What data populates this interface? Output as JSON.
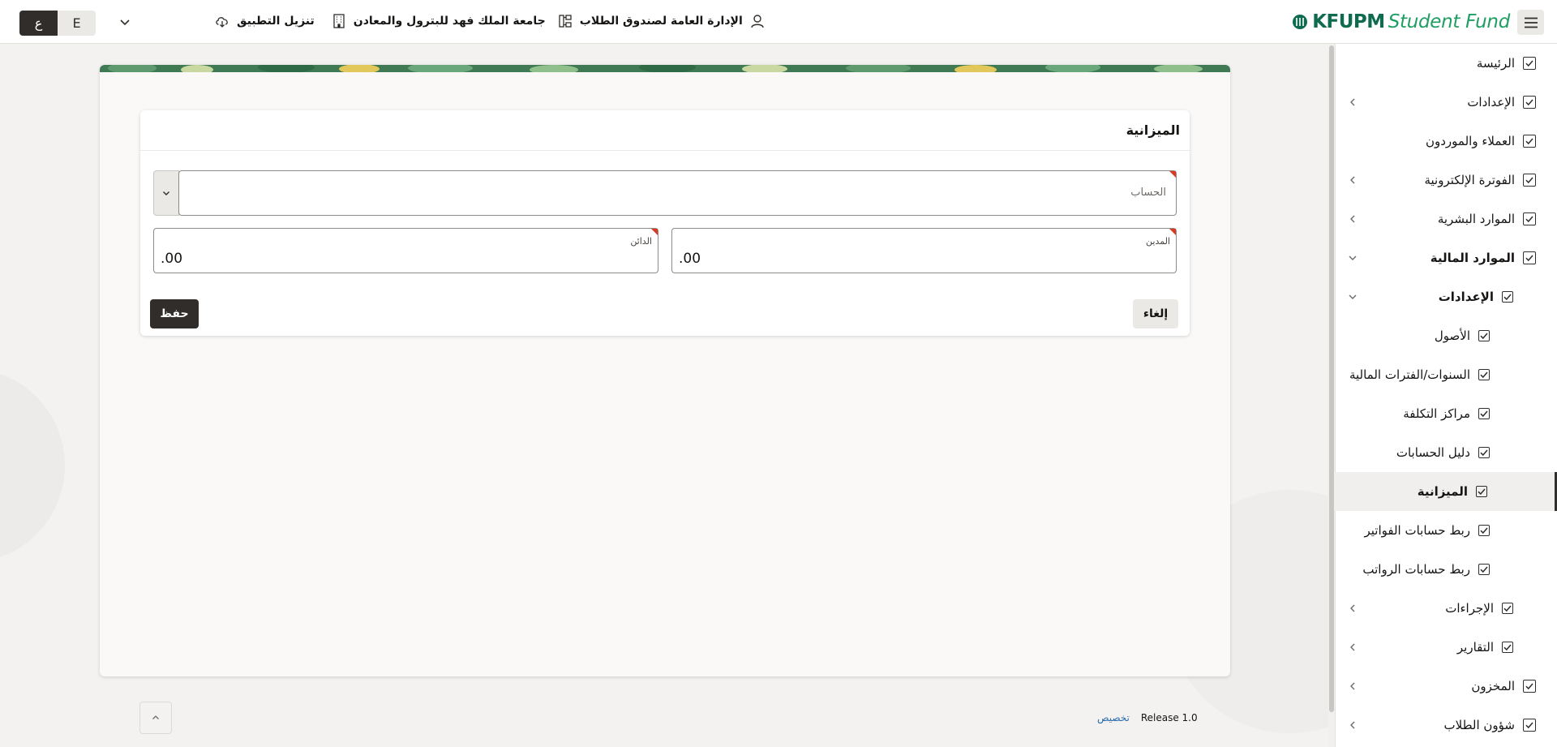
{
  "header": {
    "lang_ar": "ع",
    "lang_en": "E",
    "download_app": "تنزيل التطبيق",
    "university": "جامعة الملك فهد للبترول والمعادن",
    "department": "الإدارة العامة لصندوق الطلاب",
    "brand_kfupm": "KFUPM",
    "brand_student_fund": "Student Fund",
    "icons": [
      "chevron-down-icon",
      "user-icon",
      "org-chart-icon",
      "building-icon",
      "cloud-download-icon",
      "hamburger-menu-icon"
    ]
  },
  "sidebar": {
    "items": [
      {
        "label": "الرئيسة",
        "level": 0,
        "expandable": false
      },
      {
        "label": "الإعدادات",
        "level": 0,
        "expandable": true
      },
      {
        "label": "العملاء والموردون",
        "level": 0,
        "expandable": false
      },
      {
        "label": "الفوترة الإلكترونية",
        "level": 0,
        "expandable": true
      },
      {
        "label": "الموارد البشرية",
        "level": 0,
        "expandable": true
      },
      {
        "label": "الموارد المالية",
        "level": 0,
        "expandable": true,
        "expanded": true,
        "bold": true
      },
      {
        "label": "الإعدادات",
        "level": 1,
        "expandable": true,
        "expanded": true,
        "bold": true
      },
      {
        "label": "الأصول",
        "level": 2
      },
      {
        "label": "السنوات/الفترات المالية",
        "level": 2
      },
      {
        "label": "مراكز التكلفة",
        "level": 2
      },
      {
        "label": "دليل الحسابات",
        "level": 2
      },
      {
        "label": "الميزانية",
        "level": 2,
        "selected": true,
        "bold": true
      },
      {
        "label": "ربط حسابات الفواتير",
        "level": 2
      },
      {
        "label": "ربط حسابات الرواتب",
        "level": 2
      },
      {
        "label": "الإجراءات",
        "level": 1,
        "expandable": true
      },
      {
        "label": "التقارير",
        "level": 1,
        "expandable": true
      },
      {
        "label": "المخزون",
        "level": 0,
        "expandable": true
      },
      {
        "label": "شؤون الطلاب",
        "level": 0,
        "expandable": true
      }
    ]
  },
  "form": {
    "title": "الميزانية",
    "account_label": "الحساب",
    "debit_label": "المدين",
    "debit_value": ".00",
    "credit_label": "الدائن",
    "credit_value": ".00",
    "cancel_label": "إلغاء",
    "save_label": "حفظ"
  },
  "footer": {
    "release": "Release 1.0",
    "customize": "تخصيص"
  },
  "colors": {
    "brand_dark_green": "#0f6b4f",
    "brand_green": "#1e9e62",
    "primary_button": "#312d2a",
    "required_marker": "#d63b25"
  }
}
